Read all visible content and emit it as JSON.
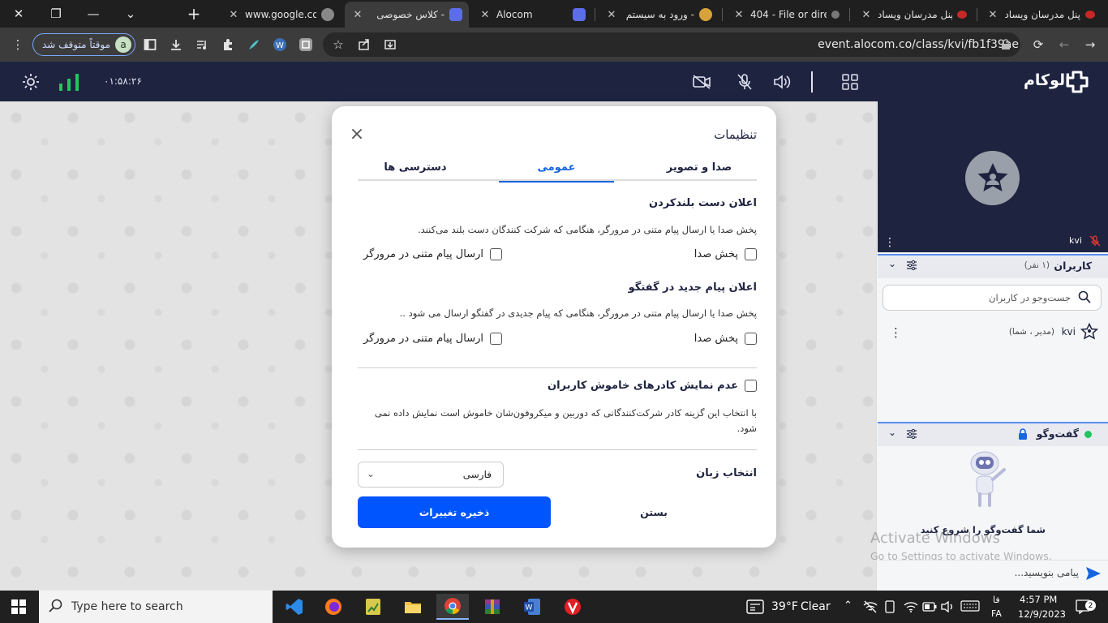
{
  "browser": {
    "tabs": [
      {
        "title": "www.google.com",
        "active": false
      },
      {
        "title": "کلاس خصوصی -",
        "active": true
      },
      {
        "title": "Alocom",
        "active": false
      },
      {
        "title": "ورود به سیستم -",
        "active": false
      },
      {
        "title": "404 - File or dire",
        "active": false
      },
      {
        "title": "پنل مدرسان ویساد",
        "active": false
      },
      {
        "title": "پنل مدرسان ویساد",
        "active": false
      }
    ],
    "new_tab": "+",
    "profile_label": "موقتاً متوقف شد",
    "profile_initial": "a",
    "url": "event.alocom.co/class/kvi/fb1f39ae"
  },
  "app": {
    "logo_text": "الوکام",
    "timer": "۰۱:۵۸:۲۶"
  },
  "modal": {
    "title": "تنظیمات",
    "tabs": [
      {
        "label": "صدا و تصویر",
        "active": false
      },
      {
        "label": "عمومی",
        "active": true
      },
      {
        "label": "دسترسی ها",
        "active": false
      }
    ],
    "section1": {
      "heading": "اعلان دست بلندکردن",
      "desc": "پخش صدا یا ارسال پیام متنی در مرورگر، هنگامی که شرکت کنندگان دست بلند می‌کنند.",
      "opt_sound": "پخش صدا",
      "opt_browser": "ارسال پیام متنی در مرورگر"
    },
    "section2": {
      "heading": "اعلان پیام جدید در گفتگو",
      "desc": "پخش صدا یا ارسال پیام متنی در مرورگر، هنگامی که پیام جدیدی در گفتگو ارسال می شود ..",
      "opt_sound": "پخش صدا",
      "opt_browser": "ارسال پیام متنی در مرورگر"
    },
    "hide_muted": {
      "label": "عدم نمایش کادرهای خاموش کاربران",
      "desc": "با انتخاب این گزینه کادر شرکت‌کنندگانی که دوربین و میکروفون‌شان خاموش است نمایش داده نمی شود."
    },
    "language_label": "انتخاب زبان",
    "language_value": "فارسی",
    "save_label": "ذخیره تغییرات",
    "cancel_label": "بستن"
  },
  "side": {
    "tile_name": "kvi",
    "users_header": "کاربران",
    "users_count": "(۱ نفر)",
    "search_placeholder": "جست‌وجو در کاربران",
    "user_name": "kvi",
    "user_role": "(مدیر ، شما)",
    "chat_header": "گفت‌وگو",
    "chat_empty": "شما گفت‌وگو را شروع کنید",
    "message_placeholder": "پیامی بنویسید..."
  },
  "watermark": {
    "line1": "Activate Windows",
    "line2": "Go to Settings to activate Windows."
  },
  "taskbar": {
    "search_placeholder": "Type here to search",
    "weather_temp": "39°F",
    "weather_text": "Clear",
    "lang_top": "فا",
    "lang_bottom": "FA",
    "time": "4:57 PM",
    "date": "12/9/2023",
    "notif_count": "2"
  },
  "colors": {
    "accent": "#0055ff",
    "appbar": "#1e2340",
    "online": "#22c55e",
    "mic_off": "#e53935"
  }
}
